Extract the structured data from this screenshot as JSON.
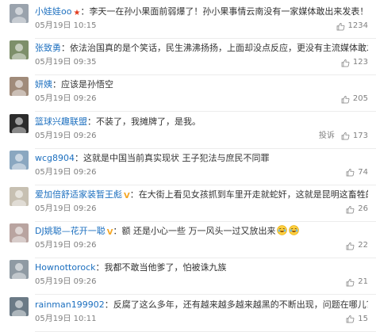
{
  "colors": {
    "link": "#1c6fbf",
    "text": "#333333",
    "meta": "#808080",
    "divider": "#ececec"
  },
  "comments": [
    {
      "user": "小娃娃oo",
      "badge": "star",
      "text": "李天一在孙小果面前弱爆了！孙小果事情云南没有一家媒体敢出来发表！",
      "emojis": [
        "laugh-cry-emoji"
      ],
      "time": "05月19日 10:15",
      "report": "",
      "likes": "1234",
      "avatar_color": "#9aa3ad"
    },
    {
      "user": "张致勇",
      "badge": "",
      "text": "依法治国真的是个笑话，民生沸沸扬扬，上面却没点反应，更没有主流媒体敢发声。",
      "emojis": [],
      "time": "05月19日 09:35",
      "report": "",
      "likes": "123",
      "avatar_color": "#7d8f6a"
    },
    {
      "user": "妍姨",
      "badge": "",
      "text": "应该是孙悟空",
      "emojis": [],
      "time": "05月19日 09:26",
      "report": "",
      "likes": "205",
      "avatar_color": "#a08b7a"
    },
    {
      "user": "篮球兴趣联盟",
      "badge": "",
      "text": "不装了，我摊牌了，是我。",
      "emojis": [],
      "time": "05月19日 09:26",
      "report": "投诉",
      "likes": "173",
      "avatar_color": "#2b2b2b"
    },
    {
      "user": "wcg8904",
      "badge": "",
      "text": "这就是中国当前真实现状 王子犯法与庶民不同罪",
      "emojis": [],
      "time": "05月19日 09:26",
      "report": "",
      "likes": "74",
      "avatar_color": "#8aa7c0"
    },
    {
      "user": "爱加倍舒适家装暂王彪",
      "badge": "vip",
      "text": "在大街上看见女孩抓到车里开走就蛇奸，这就是昆明这畜牲的作为。",
      "emojis": [],
      "time": "05月19日 09:26",
      "report": "",
      "likes": "26",
      "avatar_color": "#c7c0b2"
    },
    {
      "user": "DJ姚聪—花开一聪",
      "badge": "vip",
      "text": "额 还是小心一些 万一风头一过又放出来",
      "emojis": [
        "laugh-cry-emoji",
        "laugh-cry-emoji"
      ],
      "time": "05月19日 09:26",
      "report": "",
      "likes": "22",
      "avatar_color": "#b9a4a0"
    },
    {
      "user": "Hownottorock",
      "badge": "",
      "text": "我都不敢当他爹了，怕被诛九族",
      "emojis": [],
      "time": "05月19日 09:26",
      "report": "",
      "likes": "21",
      "avatar_color": "#8f9aa3"
    },
    {
      "user": "rainman199902",
      "badge": "",
      "text": "反腐了这么多年，还有越来越多越来越黑的不断出现，问题在哪儿？",
      "emojis": [],
      "time": "05月19日 10:11",
      "report": "",
      "likes": "15",
      "avatar_color": "#6b7a86"
    }
  ]
}
